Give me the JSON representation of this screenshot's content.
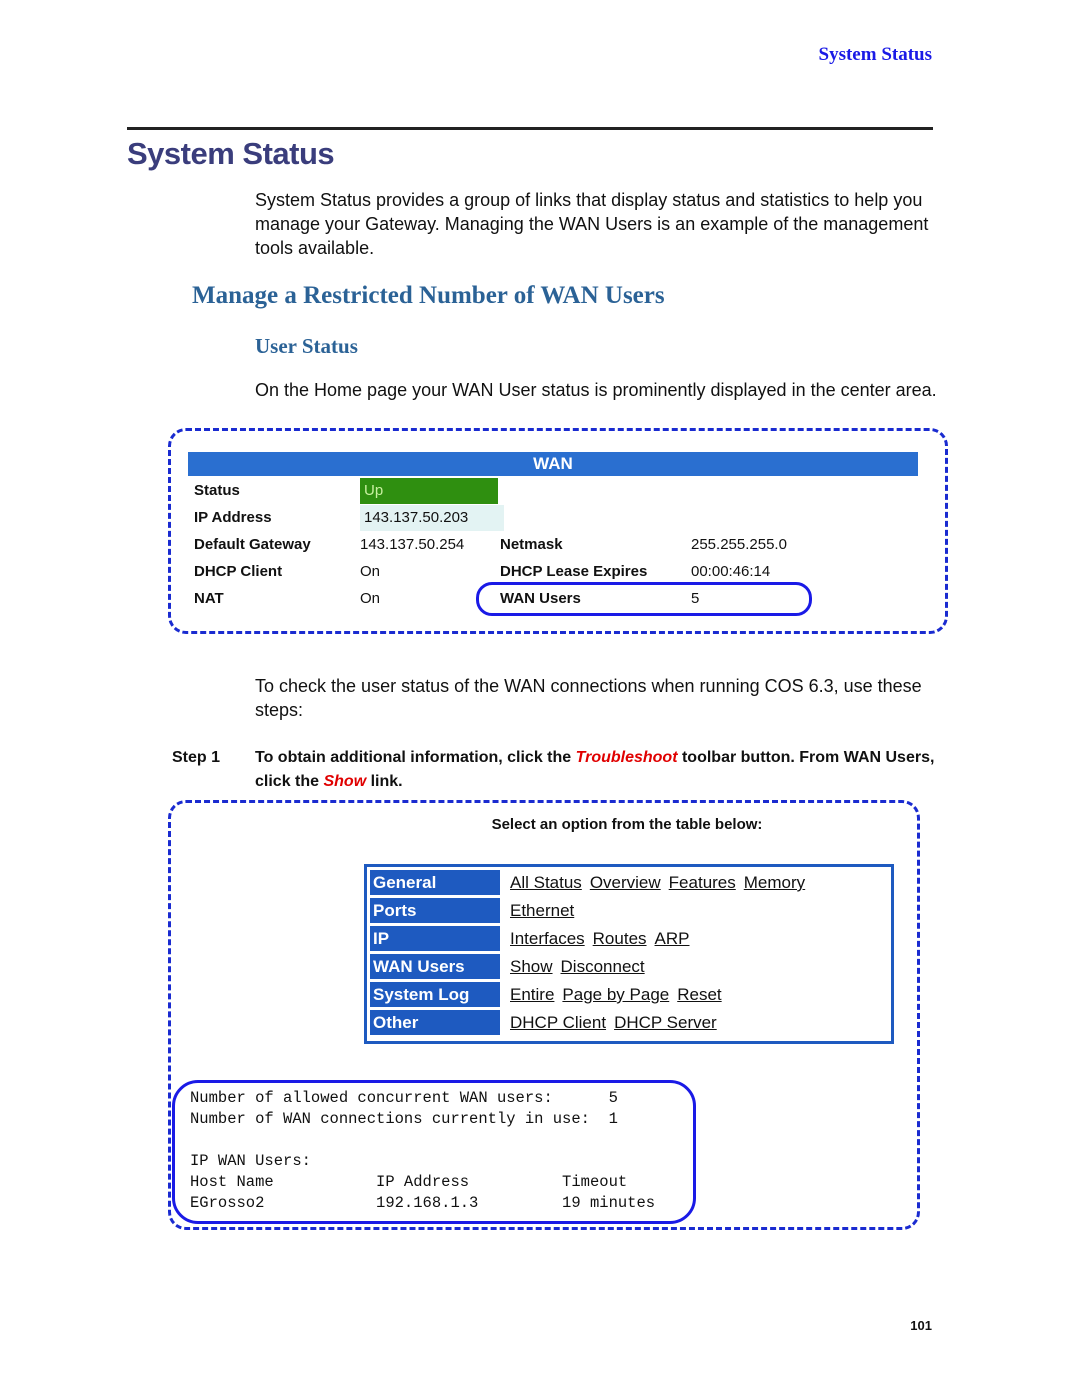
{
  "running_head": "System Status",
  "page_title": "System Status",
  "intro_paragraph": "System Status provides a group of links that display status and statistics to help you manage your Gateway. Managing the WAN Users is an example of the management tools available.",
  "section_heading": "Manage a Restricted Number of WAN Users",
  "subsection_heading": "User Status",
  "home_paragraph": "On the Home page your WAN User status is prominently displayed in the center area.",
  "wan_panel": {
    "title": "WAN",
    "rows": [
      {
        "label": "Status",
        "value": "Up",
        "label2": "",
        "value2": ""
      },
      {
        "label": "IP Address",
        "value": "143.137.50.203",
        "label2": "",
        "value2": ""
      },
      {
        "label": "Default Gateway",
        "value": "143.137.50.254",
        "label2": "Netmask",
        "value2": "255.255.255.0"
      },
      {
        "label": "DHCP Client",
        "value": "On",
        "label2": "DHCP Lease Expires",
        "value2": "00:00:46:14"
      },
      {
        "label": "NAT",
        "value": "On",
        "label2": "WAN Users",
        "value2": "5"
      }
    ]
  },
  "check_paragraph": "To check the user status of the WAN connections when running COS 6.3, use these steps:",
  "step": {
    "label": "Step 1",
    "text_a": "To obtain additional information, click the ",
    "em1": "Troubleshoot",
    "text_b": " toolbar button. From WAN Users, click the ",
    "em2": "Show",
    "text_c": " link."
  },
  "options_panel": {
    "title": "Select an option from the table below:",
    "rows": [
      {
        "category": "General",
        "links": [
          "All Status",
          "Overview",
          "Features",
          "Memory"
        ]
      },
      {
        "category": "Ports",
        "links": [
          "Ethernet"
        ]
      },
      {
        "category": "IP",
        "links": [
          "Interfaces",
          "Routes",
          "ARP"
        ]
      },
      {
        "category": "WAN Users",
        "links": [
          "Show",
          "Disconnect"
        ]
      },
      {
        "category": "System Log",
        "links": [
          "Entire",
          "Page by Page",
          "Reset"
        ]
      },
      {
        "category": "Other",
        "links": [
          "DHCP Client",
          "DHCP Server"
        ]
      }
    ]
  },
  "wan_users_output": {
    "lines": [
      "Number of allowed concurrent WAN users:      5",
      "Number of WAN connections currently in use:  1",
      "",
      "IP WAN Users:",
      "Host Name           IP Address          Timeout",
      "EGrosso2            192.168.1.3         19 minutes"
    ]
  },
  "page_number": "101",
  "colors": {
    "running_head": "#1a1ae6",
    "title": "#3a3d7c",
    "heading": "#2b6296",
    "panel_blue": "#1e5ac0",
    "status_up": "#2f8f10",
    "emphasis_red": "#e00000"
  }
}
